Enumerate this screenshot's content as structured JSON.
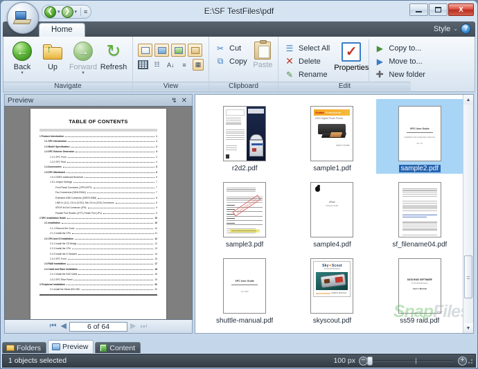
{
  "window": {
    "title": "E:\\SF TestFiles\\pdf",
    "minimize_label": "Minimize",
    "maximize_label": "Maximize",
    "close_label": "X"
  },
  "quick_access": {
    "back_glyph": "❮",
    "forward_glyph": "❯",
    "caret": "▾",
    "more_glyph": "≡"
  },
  "ribbon": {
    "tab_label": "Home",
    "style_label": "Style",
    "style_caret": "⌄",
    "help_label": "?",
    "groups": [
      {
        "name": "Navigate",
        "label": "Navigate",
        "buttons": [
          {
            "label": "Back",
            "icon": "back-arrow-icon",
            "glyph": "←",
            "has_dropdown": true,
            "disabled": false
          },
          {
            "label": "Up",
            "icon": "folder-up-icon",
            "glyph": "↑",
            "has_dropdown": false,
            "disabled": false
          },
          {
            "label": "Forward",
            "icon": "forward-arrow-icon",
            "glyph": "→",
            "has_dropdown": true,
            "disabled": true
          },
          {
            "label": "Refresh",
            "icon": "refresh-icon",
            "glyph": "↻",
            "has_dropdown": false,
            "disabled": false
          }
        ]
      },
      {
        "name": "View",
        "label": "View",
        "top_icons": [
          {
            "icon": "view-preview-pane-icon"
          },
          {
            "icon": "view-thumbnails-icon"
          },
          {
            "icon": "view-content-pane-icon"
          },
          {
            "icon": "view-details-icon"
          }
        ],
        "bottom_icons": [
          {
            "icon": "view-grid-icon"
          },
          {
            "icon": "view-list-icon"
          },
          {
            "icon": "view-sort-icon"
          },
          {
            "icon": "view-group-icon"
          },
          {
            "icon": "view-tiles-icon",
            "selected": true
          }
        ]
      },
      {
        "name": "Clipboard",
        "label": "Clipboard",
        "items": [
          {
            "label": "Cut",
            "icon": "scissors-icon",
            "glyph": "✂",
            "disabled": false
          },
          {
            "label": "Copy",
            "icon": "copy-icon",
            "glyph": "⧉",
            "disabled": false
          },
          {
            "label": "Paste",
            "icon": "paste-icon",
            "disabled": true
          }
        ]
      },
      {
        "name": "Edit",
        "label": "Edit",
        "items": [
          {
            "label": "Select All",
            "icon": "select-all-icon",
            "glyph": "☰"
          },
          {
            "label": "Delete",
            "icon": "delete-icon",
            "glyph": "✕"
          },
          {
            "label": "Rename",
            "icon": "rename-icon",
            "glyph": "✎"
          },
          {
            "label": "Properties",
            "icon": "properties-icon",
            "glyph": "✓"
          },
          {
            "label": "Copy to...",
            "icon": "copy-to-icon",
            "glyph": "▶"
          },
          {
            "label": "Move to...",
            "icon": "move-to-icon",
            "glyph": "▶"
          },
          {
            "label": "New folder",
            "icon": "new-folder-icon",
            "glyph": "➕"
          }
        ]
      }
    ]
  },
  "preview": {
    "title": "Preview",
    "pin_glyph": "↯",
    "close_glyph": "✕",
    "page_indicator": "6 of 64",
    "nav": {
      "first": "⏮",
      "prev": "◀",
      "next": "▶",
      "last": "⏭"
    },
    "document": {
      "heading": "TABLE OF CONTENTS",
      "entries": [
        {
          "level": 1,
          "bold": true,
          "text": "1 Product Introduction",
          "page": "1"
        },
        {
          "level": 2,
          "bold": true,
          "text": "1.1 SPC Introduction",
          "page": "1"
        },
        {
          "level": 2,
          "bold": true,
          "text": "1.2 Model Specification",
          "page": "2"
        },
        {
          "level": 2,
          "bold": true,
          "text": "1.3 SPC Exterior Dimension",
          "page": "3"
        },
        {
          "level": 3,
          "bold": false,
          "text": "1.3.1 SPC Front",
          "page": "3"
        },
        {
          "level": 3,
          "bold": false,
          "text": "1.3.2 SPC Rear",
          "page": "4"
        },
        {
          "level": 2,
          "bold": true,
          "text": "1.4 Accessories",
          "page": "5"
        },
        {
          "level": 2,
          "bold": true,
          "text": "1.5 SPC Mainboard",
          "page": "6"
        },
        {
          "level": 3,
          "bold": false,
          "text": "1.5.1 DDR3 mainboard flowchart",
          "page": "6"
        },
        {
          "level": 3,
          "bold": false,
          "text": "1.5.2 Jumper Settings",
          "page": "7"
        },
        {
          "level": 4,
          "bold": false,
          "text": "Front Panel Connector (JFP1/JFP2)",
          "page": "7"
        },
        {
          "level": 4,
          "bold": false,
          "text": "Fan Connectors (FAN1/FAN2)",
          "page": "7"
        },
        {
          "level": 4,
          "bold": false,
          "text": "Extended USB Connector (USB7/USB8)",
          "page": "8"
        },
        {
          "level": 4,
          "bold": false,
          "text": "LINE-in (JL1), CD-in (JCD1), Mic-CD-in (JCN) Connectors",
          "page": "8"
        },
        {
          "level": 4,
          "bold": false,
          "text": "SPDIF In/Out Connector (JP6)",
          "page": "9"
        },
        {
          "level": 4,
          "bold": false,
          "text": "Parallel Port Header (LPT1) Printer Port (JP1)",
          "page": "9"
        },
        {
          "level": 1,
          "bold": true,
          "text": "2 SPC Installation Guide",
          "page": "10"
        },
        {
          "level": 2,
          "bold": true,
          "text": "2.1 Installation",
          "page": "10"
        },
        {
          "level": 3,
          "bold": false,
          "text": "2.1.1 Remove the Cover",
          "page": "10"
        },
        {
          "level": 3,
          "bold": false,
          "text": "2.1.2 Install the CPU",
          "page": "11"
        },
        {
          "level": 2,
          "bold": true,
          "text": "2.2 CPU and IO Installation",
          "page": "12"
        },
        {
          "level": 3,
          "bold": false,
          "text": "2.2.1 Install the CD Bridge",
          "page": "12"
        },
        {
          "level": 3,
          "bold": false,
          "text": "2.2.2 Install the CPU",
          "page": "13"
        },
        {
          "level": 3,
          "bold": false,
          "text": "2.2.3 Install the IO Bracket",
          "page": "14"
        },
        {
          "level": 3,
          "bold": false,
          "text": "2.2.4 SPC Front",
          "page": "15"
        },
        {
          "level": 2,
          "bold": true,
          "text": "2.3 RAM Installation",
          "page": "17"
        },
        {
          "level": 2,
          "bold": true,
          "text": "2.4 Cable and Rack Installation",
          "page": "18"
        },
        {
          "level": 3,
          "bold": false,
          "text": "2.4.1 Install the SAS Cable",
          "page": "18"
        },
        {
          "level": 3,
          "bold": false,
          "text": "2.4.2 SPC Rear Panel",
          "page": "19"
        },
        {
          "level": 1,
          "bold": true,
          "text": "3 Peripheral Installation",
          "page": "20"
        },
        {
          "level": 3,
          "bold": false,
          "text": "3.1 Install the Serial ATA HDD",
          "page": "20"
        }
      ]
    }
  },
  "files": [
    {
      "name": "r2d2.pdf",
      "thumb": "r2d2",
      "selected": false
    },
    {
      "name": "sample1.pdf",
      "thumb": "kodak",
      "selected": false
    },
    {
      "name": "sample2.pdf",
      "thumb": "userguide",
      "selected": true
    },
    {
      "name": "sample3.pdf",
      "thumb": "sample3",
      "selected": false
    },
    {
      "name": "sample4.pdf",
      "thumb": "apple",
      "selected": false
    },
    {
      "name": "sf_filename04.pdf",
      "thumb": "text",
      "selected": false
    },
    {
      "name": "shuttle-manual.pdf",
      "thumb": "shuttle",
      "selected": false
    },
    {
      "name": "skyscout.pdf",
      "thumb": "skyscout",
      "selected": false
    },
    {
      "name": "ss59 raid.pdf",
      "thumb": "ss59",
      "selected": false
    }
  ],
  "thumb_text": {
    "kodak_brand": "Kodak",
    "kodak_sub": "Professional",
    "kodak_model": "1400 Digital Photo Printer",
    "kodak_foot": "User's Guide",
    "sample3_stamp": "CONFIDENTIAL",
    "apple_title": "iPod",
    "apple_sub": "Features Guide",
    "userguide_title": "SPC User Guide",
    "userguide_sub": "Installation and configuration reference",
    "userguide_ver": "Ver. 1.0",
    "shuttle_title": "XPC User Guide",
    "shuttle_sub": "Ver. 2010",
    "sky_logo_a": "Sky",
    "sky_logo_b": "Scout",
    "sky_sub": "Personal Planetarium",
    "sky_manual": "USER'S MANUAL",
    "sky_brand": "CELESTRON",
    "ss59_t1": "DATA RAID SOFTWARE",
    "ss59_t2": "for SS 59 RAID Series",
    "ss59_t3": "User's Manual"
  },
  "watermark": {
    "part1": "Snap",
    "part2": "Files"
  },
  "bottom_tabs": [
    {
      "label": "Folders",
      "icon": "folders-icon",
      "active": false
    },
    {
      "label": "Preview",
      "icon": "preview-icon",
      "active": true
    },
    {
      "label": "Content",
      "icon": "content-icon",
      "active": false
    }
  ],
  "status": {
    "text": "1 objects selected",
    "zoom_value": "100 px",
    "zoom_out": "−",
    "zoom_in": "+"
  },
  "colors": {
    "accent": "#2563b0",
    "selection": "#a8d4f5",
    "green": "#5cb135",
    "close_red": "#d9493a"
  }
}
